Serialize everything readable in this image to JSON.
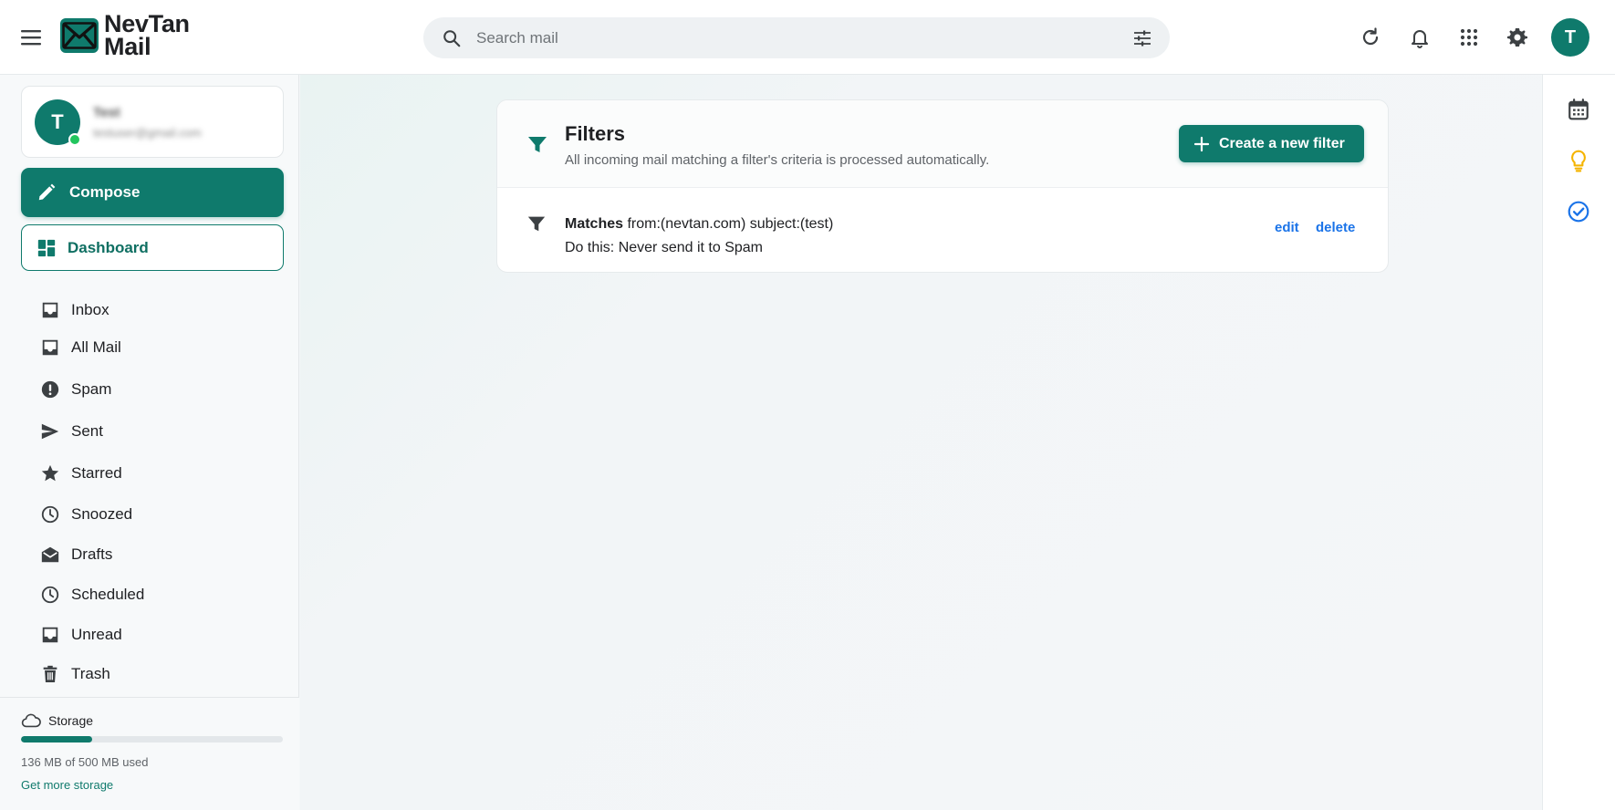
{
  "app": {
    "logo_line1": "NevTan",
    "logo_line2": "Mail"
  },
  "search": {
    "placeholder": "Search mail"
  },
  "user": {
    "initial": "T",
    "name": "Test",
    "email": "testuser@gmail.com"
  },
  "sidebar": {
    "compose_label": "Compose",
    "dashboard_label": "Dashboard",
    "items": [
      {
        "label": "Inbox",
        "icon": "inbox-icon"
      },
      {
        "label": "All Mail",
        "icon": "inbox-icon"
      },
      {
        "label": "Spam",
        "icon": "spam-icon"
      },
      {
        "label": "Sent",
        "icon": "send-icon"
      },
      {
        "label": "Starred",
        "icon": "star-icon"
      },
      {
        "label": "Snoozed",
        "icon": "clock-icon"
      },
      {
        "label": "Drafts",
        "icon": "drafts-icon"
      },
      {
        "label": "Scheduled",
        "icon": "clock-icon"
      },
      {
        "label": "Unread",
        "icon": "inbox-icon"
      },
      {
        "label": "Trash",
        "icon": "trash-icon"
      }
    ]
  },
  "storage": {
    "title": "Storage",
    "used_text": "136 MB of 500 MB used",
    "used_fraction": 0.272,
    "link": "Get more storage"
  },
  "filters": {
    "title": "Filters",
    "subtitle": "All incoming mail matching a filter's criteria is processed automatically.",
    "create_label": "Create a new filter",
    "rows": [
      {
        "matches_label": "Matches",
        "criteria": "from:(nevtan.com) subject:(test)",
        "action": "Do this: Never send it to Spam",
        "edit_label": "edit",
        "delete_label": "delete"
      }
    ]
  },
  "colors": {
    "brand": "#0f7a6c",
    "link": "#1a73e8",
    "online": "#22c55e",
    "keep": "#f5b400"
  }
}
